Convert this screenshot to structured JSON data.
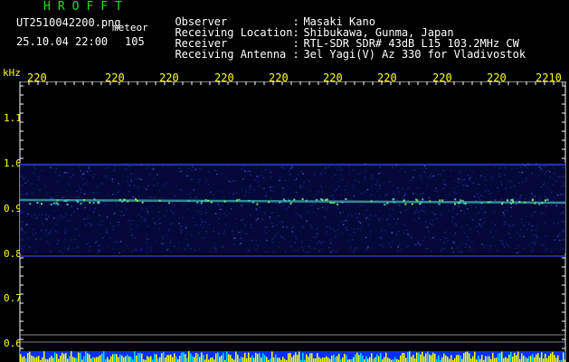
{
  "header": {
    "app_title": "HROFFT",
    "filename": "UT2510042200.png",
    "meteor_label": "meteor",
    "datetime": "25.10.04 22:00",
    "count": "105"
  },
  "info": [
    {
      "label": "Observer",
      "sep": ":",
      "value": "Masaki Kano"
    },
    {
      "label": "Receiving Location",
      "sep": ":",
      "value": "Shibukawa, Gunma, Japan"
    },
    {
      "label": "Receiver",
      "sep": ":",
      "value": "RTL-SDR SDR# 43dB L15 103.2MHz CW"
    },
    {
      "label": "Receiving Antenna",
      "sep": ":",
      "value": "3el Yagi(V) Az 330 for Vladivostok"
    }
  ],
  "axis": {
    "y_unit": "kHz",
    "x_ticks": [
      "220",
      "220",
      "220",
      "220",
      "220",
      "220",
      "220",
      "220",
      "220",
      "2210"
    ],
    "y_ticks": [
      "1.1",
      "1.0",
      "0.9",
      "0.8",
      "0.7",
      "0.6"
    ]
  },
  "colors": {
    "background": "#000000",
    "axis_text": "#ffff00",
    "title": "#21e021",
    "signal": "#2030c0",
    "echo": "#40c080"
  }
}
